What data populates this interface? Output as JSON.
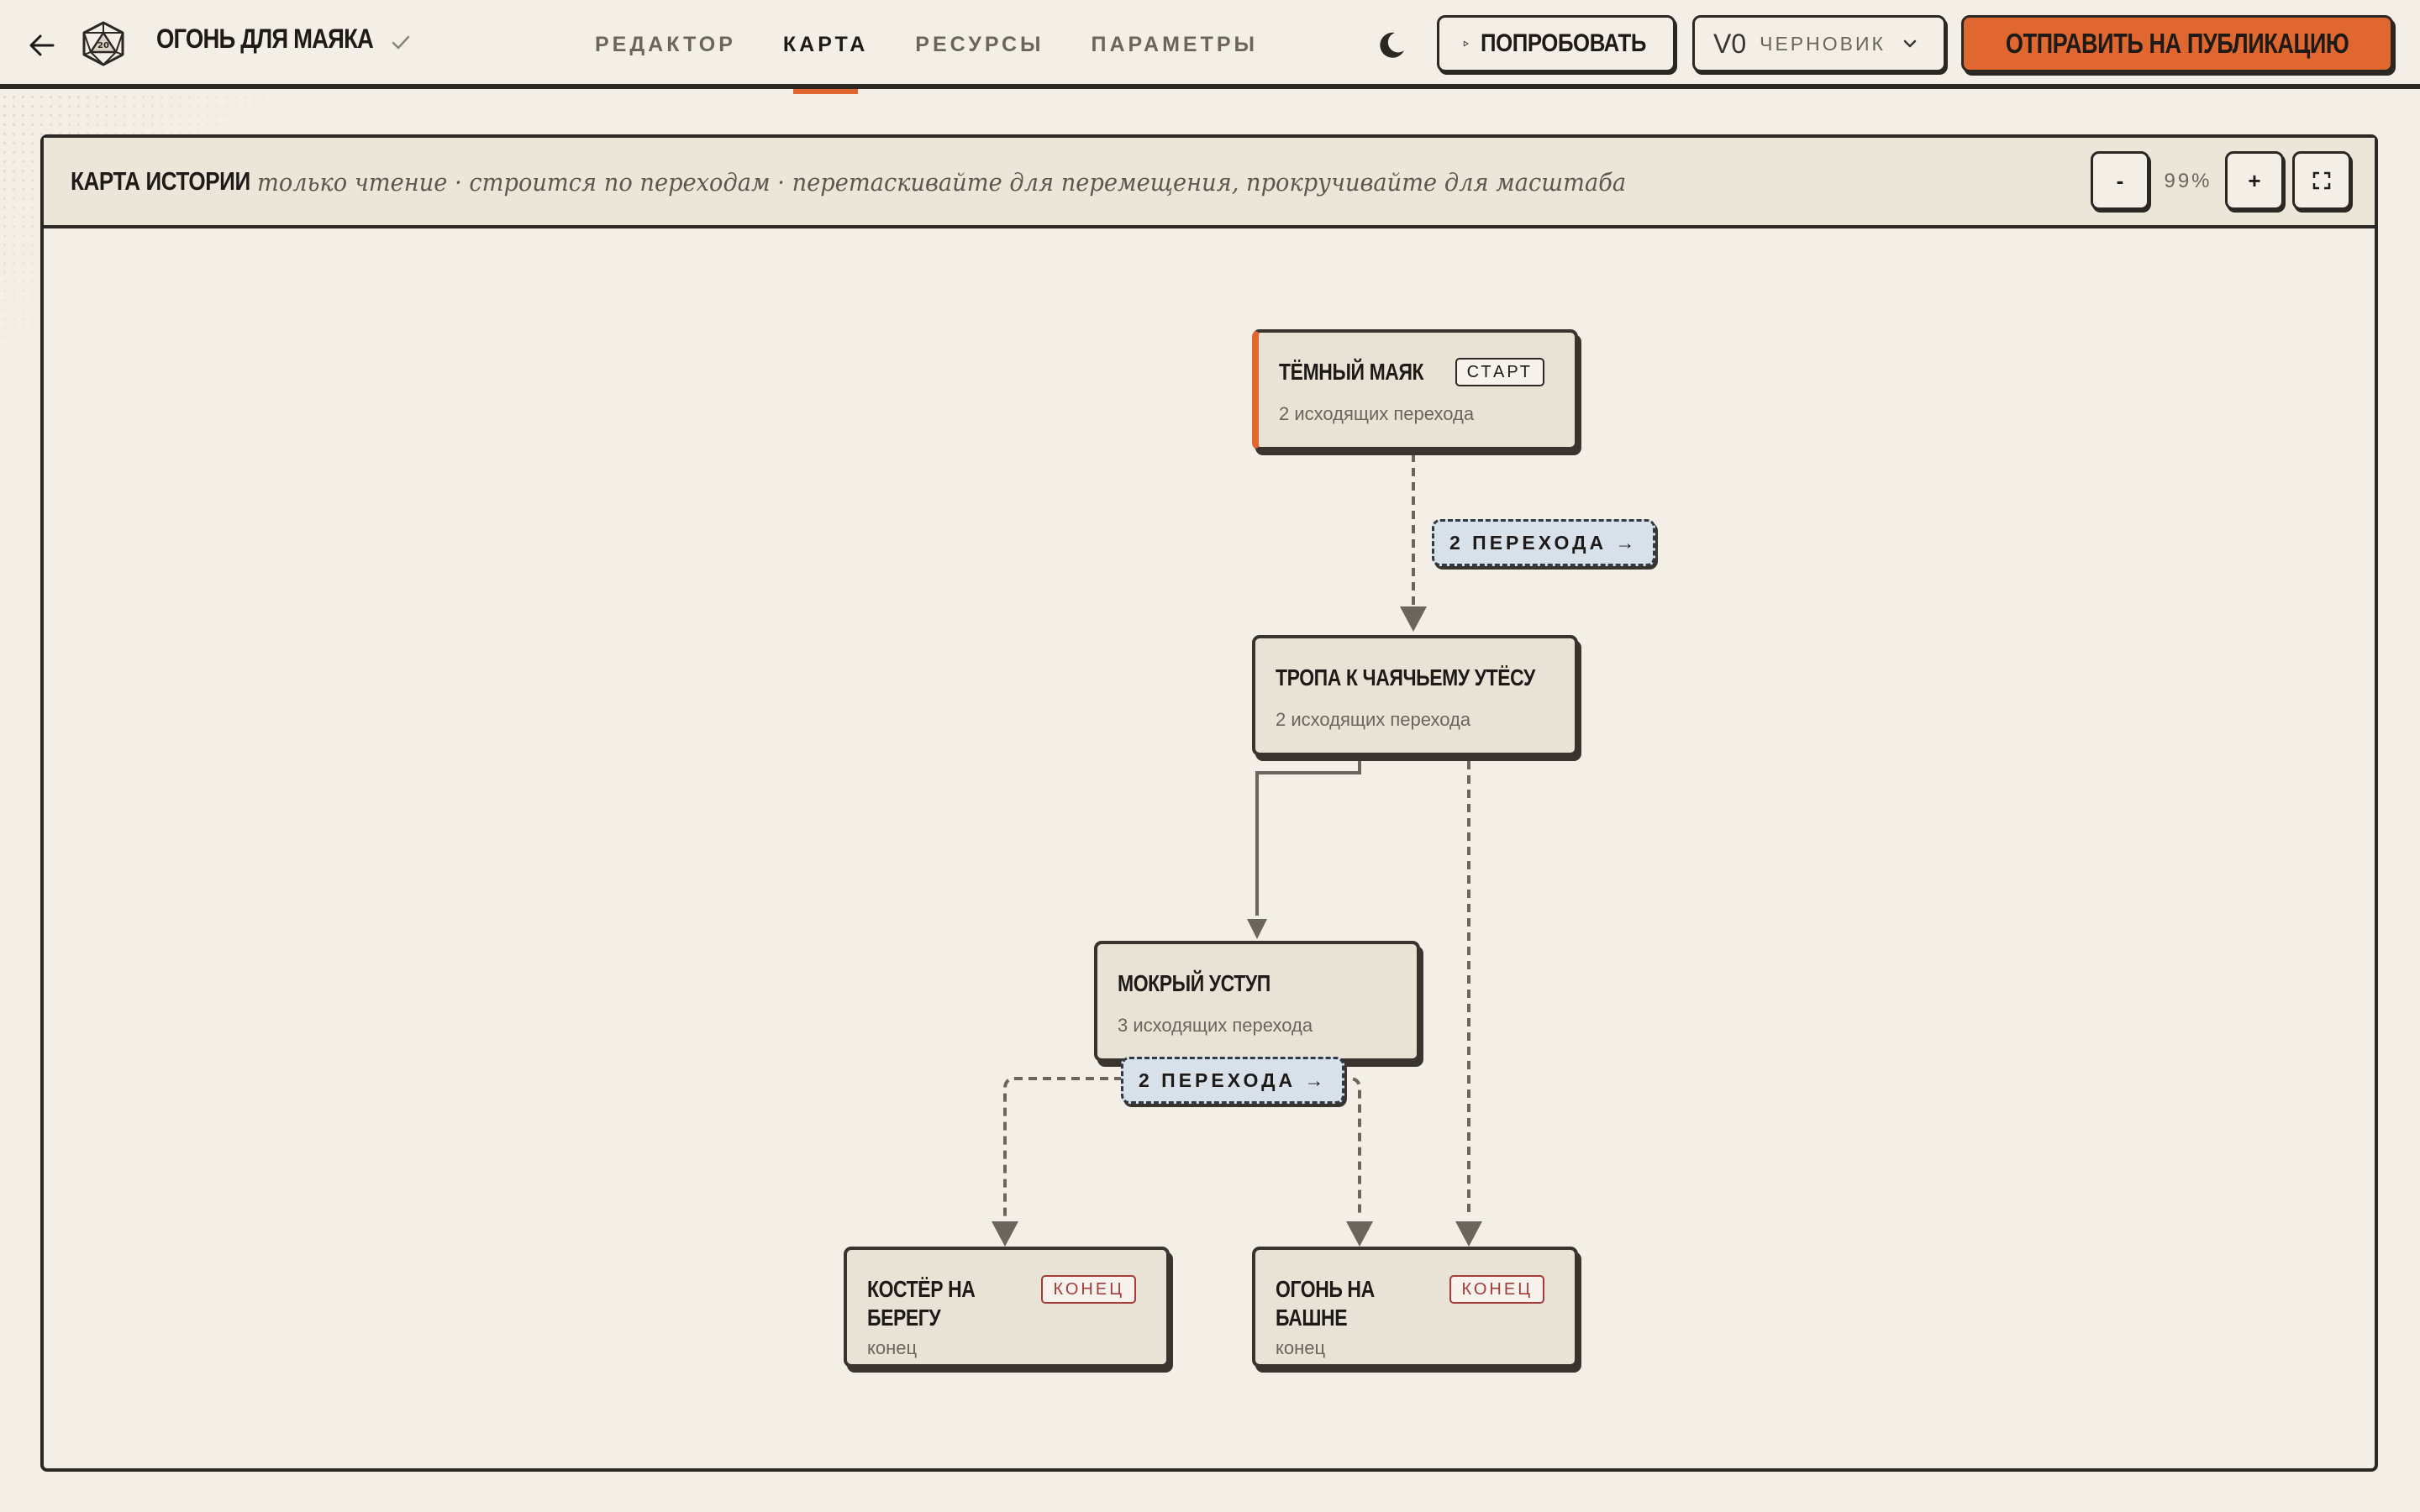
{
  "app": {
    "title": "ОГОНЬ ДЛЯ МАЯКА",
    "icons": {
      "back": "arrow-left-icon",
      "logo": "d20-dice-icon",
      "saved": "check-icon",
      "theme": "moon-icon"
    }
  },
  "nav": {
    "tabs": [
      {
        "label": "РЕДАКТОР",
        "active": false
      },
      {
        "label": "КАРТА",
        "active": true
      },
      {
        "label": "РЕСУРСЫ",
        "active": false
      },
      {
        "label": "ПАРАМЕТРЫ",
        "active": false
      }
    ]
  },
  "actions": {
    "try_label": "ПОПРОБОВАТЬ",
    "version": "V0",
    "version_state": "ЧЕРНОВИК",
    "publish_label": "ОТПРАВИТЬ НА ПУБЛИКАЦИЮ"
  },
  "map": {
    "title": "КАРТА ИСТОРИИ",
    "subtitle": "только чтение · строится по переходам · перетаскивайте для перемещения, прокручивайте для масштаба",
    "zoom_out_label": "-",
    "zoom_level": "99%",
    "zoom_in_label": "+",
    "accent_color": "#e0672f",
    "edge_label_color": "#d8e1ea",
    "nodes": [
      {
        "id": "dark-lighthouse",
        "title": "ТЁМНЫЙ МАЯК",
        "badge": "СТАРТ",
        "subtitle": "2 исходящих перехода"
      },
      {
        "id": "gull-cliff-path",
        "title": "ТРОПА К ЧАЯЧЬЕМУ УТЁСУ",
        "badge": "",
        "subtitle": "2 исходящих перехода"
      },
      {
        "id": "wet-ledge",
        "title": "МОКРЫЙ УСТУП",
        "badge": "",
        "subtitle": "3 исходящих перехода"
      },
      {
        "id": "shore-bonfire",
        "title": "КОСТЁР НА БЕРЕГУ",
        "badge": "КОНЕЦ",
        "subtitle": "конец"
      },
      {
        "id": "tower-fire",
        "title": "ОГОНЬ НА БАШНЕ",
        "badge": "КОНЕЦ",
        "subtitle": "конец"
      }
    ],
    "edge_labels": [
      {
        "text": "2 ПЕРЕХОДА →"
      },
      {
        "text": "2 ПЕРЕХОДА →"
      }
    ]
  }
}
